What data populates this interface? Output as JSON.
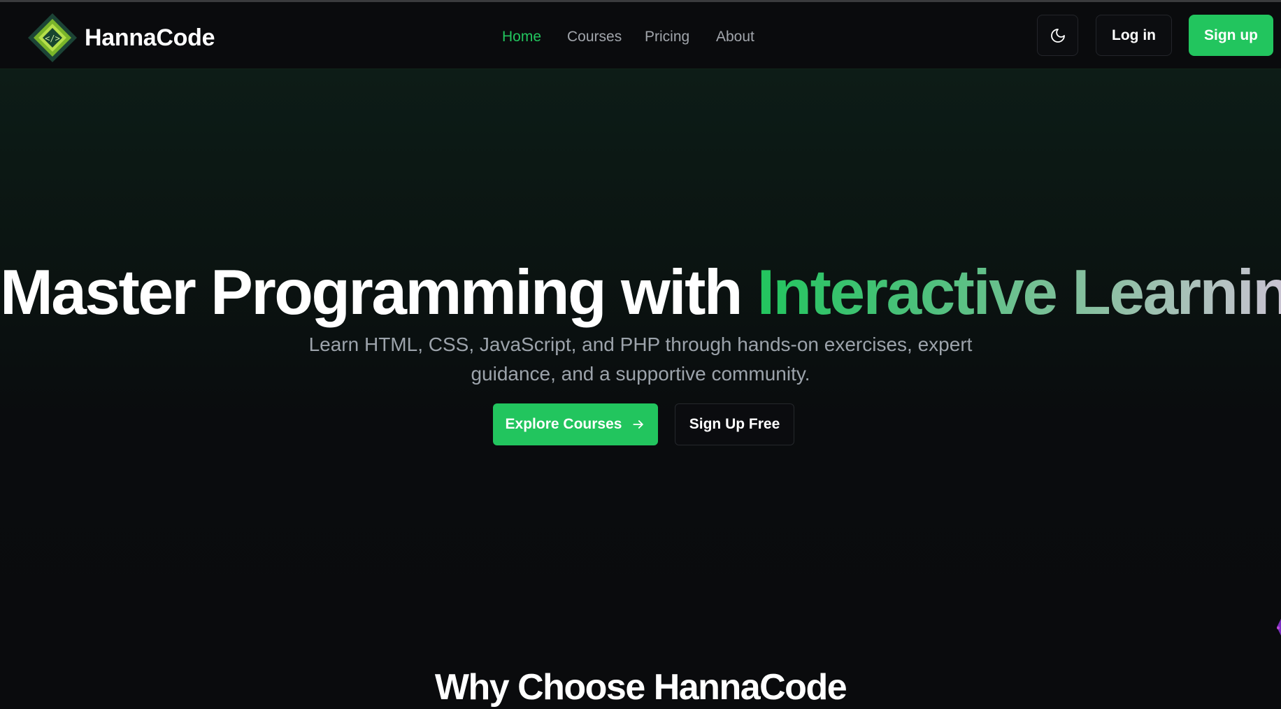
{
  "brand": {
    "name": "HannaCode",
    "logo_icon": "code-diamond-logo",
    "colors": {
      "accent": "#22c55e",
      "background": "#0a0b0d"
    }
  },
  "nav": {
    "items": [
      {
        "label": "Home",
        "active": true
      },
      {
        "label": "Courses",
        "active": false
      },
      {
        "label": "Pricing",
        "active": false
      },
      {
        "label": "About",
        "active": false
      }
    ]
  },
  "header_actions": {
    "theme_icon": "moon-icon",
    "login_label": "Log in",
    "signup_label": "Sign up"
  },
  "hero": {
    "title_plain": "Master Programming with",
    "title_highlight": "Interactive Learning",
    "subtitle_line1": "Learn HTML, CSS, JavaScript, and PHP through hands-on exercises, expert",
    "subtitle_line2": "guidance, and a supportive community.",
    "primary_cta": "Explore Courses",
    "primary_cta_icon": "arrow-right-icon",
    "secondary_cta": "Sign Up Free"
  },
  "features_section": {
    "title": "Why Choose HannaCode"
  }
}
